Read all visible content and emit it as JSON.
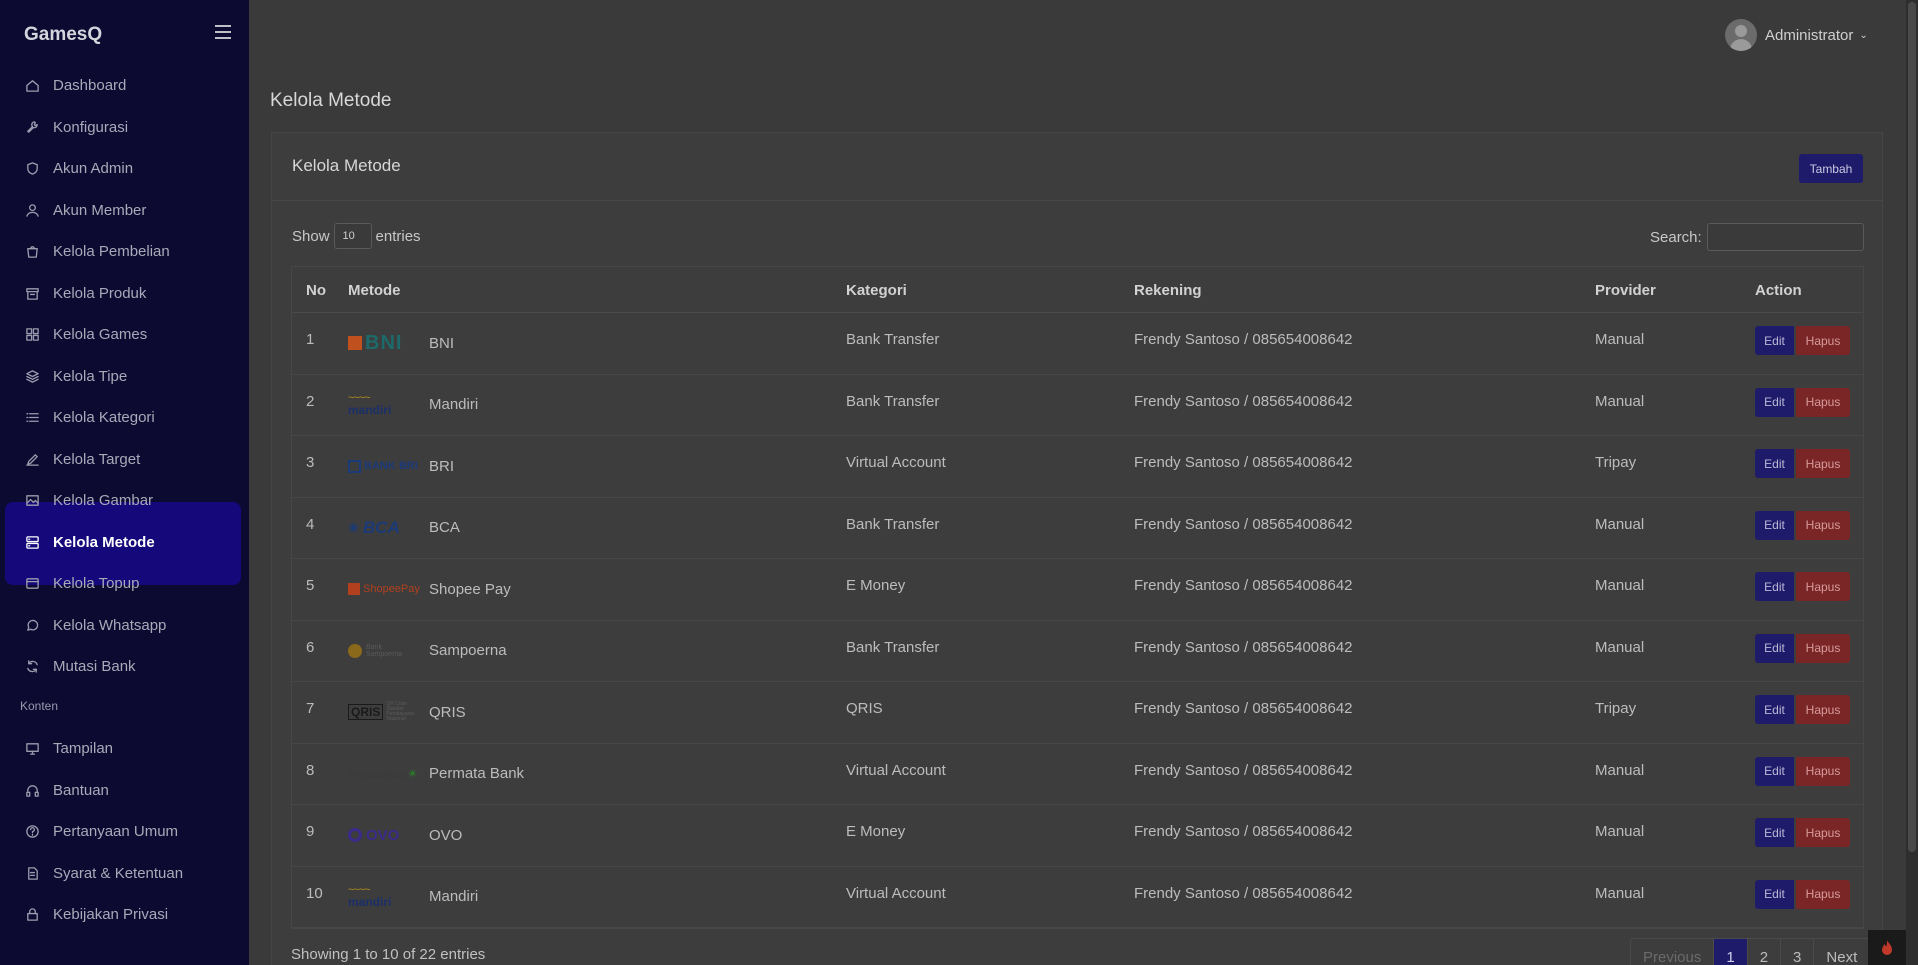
{
  "brand": "GamesQ",
  "sidebar": {
    "items": [
      {
        "label": "Dashboard",
        "icon": "home-icon"
      },
      {
        "label": "Konfigurasi",
        "icon": "wrench-icon"
      },
      {
        "label": "Akun Admin",
        "icon": "shield-icon"
      },
      {
        "label": "Akun Member",
        "icon": "user-icon"
      },
      {
        "label": "Kelola Pembelian",
        "icon": "bag-icon"
      },
      {
        "label": "Kelola Produk",
        "icon": "archive-icon"
      },
      {
        "label": "Kelola Games",
        "icon": "grid-icon"
      },
      {
        "label": "Kelola Tipe",
        "icon": "layers-icon"
      },
      {
        "label": "Kelola Kategori",
        "icon": "list-icon"
      },
      {
        "label": "Kelola Target",
        "icon": "pencil-icon"
      },
      {
        "label": "Kelola Gambar",
        "icon": "image-icon"
      },
      {
        "label": "Kelola Metode",
        "icon": "server-icon",
        "active": true
      },
      {
        "label": "Kelola Topup",
        "icon": "card-icon"
      },
      {
        "label": "Kelola Whatsapp",
        "icon": "chat-icon"
      },
      {
        "label": "Mutasi Bank",
        "icon": "refresh-icon"
      }
    ],
    "section_label": "Konten",
    "content_items": [
      {
        "label": "Tampilan",
        "icon": "monitor-icon"
      },
      {
        "label": "Bantuan",
        "icon": "headphones-icon"
      },
      {
        "label": "Pertanyaan Umum",
        "icon": "help-circle-icon"
      },
      {
        "label": "Syarat & Ketentuan",
        "icon": "document-icon"
      },
      {
        "label": "Kebijakan Privasi",
        "icon": "lock-icon"
      }
    ]
  },
  "header": {
    "user": "Administrator"
  },
  "page_title": "Kelola Metode",
  "card": {
    "title": "Kelola Metode",
    "add_label": "Tambah",
    "show_label": "Show",
    "entries_label": "entries",
    "length_value": "10",
    "search_label": "Search:"
  },
  "table": {
    "headers": [
      "No",
      "Metode",
      "Kategori",
      "Rekening",
      "Provider",
      "Action"
    ],
    "rows": [
      {
        "no": "1",
        "metode": "BNI",
        "logo": "BNI",
        "kategori": "Bank Transfer",
        "rekening": "Frendy Santoso / 085654008642",
        "provider": "Manual"
      },
      {
        "no": "2",
        "metode": "Mandiri",
        "logo": "mandiri",
        "kategori": "Bank Transfer",
        "rekening": "Frendy Santoso / 085654008642",
        "provider": "Manual"
      },
      {
        "no": "3",
        "metode": "BRI",
        "logo": "BANK BRI",
        "kategori": "Virtual Account",
        "rekening": "Frendy Santoso / 085654008642",
        "provider": "Tripay"
      },
      {
        "no": "4",
        "metode": "BCA",
        "logo": "BCA",
        "kategori": "Bank Transfer",
        "rekening": "Frendy Santoso / 085654008642",
        "provider": "Manual"
      },
      {
        "no": "5",
        "metode": "Shopee Pay",
        "logo": "ShopeePay",
        "kategori": "E Money",
        "rekening": "Frendy Santoso / 085654008642",
        "provider": "Manual"
      },
      {
        "no": "6",
        "metode": "Sampoerna",
        "logo": "Sampoerna",
        "kategori": "Bank Transfer",
        "rekening": "Frendy Santoso / 085654008642",
        "provider": "Manual"
      },
      {
        "no": "7",
        "metode": "QRIS",
        "logo": "QRIS",
        "kategori": "QRIS",
        "rekening": "Frendy Santoso / 085654008642",
        "provider": "Tripay"
      },
      {
        "no": "8",
        "metode": "Permata Bank",
        "logo": "PermataBank",
        "kategori": "Virtual Account",
        "rekening": "Frendy Santoso / 085654008642",
        "provider": "Manual"
      },
      {
        "no": "9",
        "metode": "OVO",
        "logo": "OVO",
        "kategori": "E Money",
        "rekening": "Frendy Santoso / 085654008642",
        "provider": "Manual"
      },
      {
        "no": "10",
        "metode": "Mandiri",
        "logo": "mandiri",
        "kategori": "Virtual Account",
        "rekening": "Frendy Santoso / 085654008642",
        "provider": "Manual"
      }
    ],
    "edit_label": "Edit",
    "delete_label": "Hapus"
  },
  "footer": {
    "info": "Showing 1 to 10 of 22 entries",
    "pagination": [
      "Previous",
      "1",
      "2",
      "3",
      "Next"
    ]
  }
}
